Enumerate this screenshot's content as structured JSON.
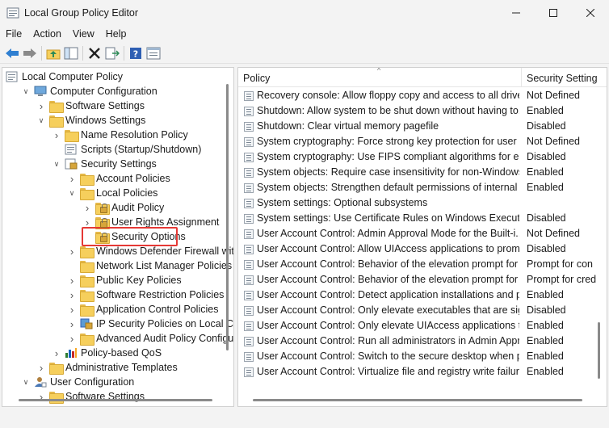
{
  "window": {
    "title": "Local Group Policy Editor"
  },
  "menu": [
    "File",
    "Action",
    "View",
    "Help"
  ],
  "toolbar": [
    "back-icon",
    "forward-icon",
    "up-folder-icon",
    "show-hide-tree-icon",
    "delete-icon",
    "export-list-icon",
    "help-icon",
    "properties-icon"
  ],
  "tree": [
    {
      "label": "Local Computer Policy",
      "icon": "computer-policy-icon",
      "depth": 0,
      "expander": ""
    },
    {
      "label": "Computer Configuration",
      "icon": "computer-icon",
      "depth": 1,
      "expander": "open"
    },
    {
      "label": "Software Settings",
      "icon": "folder-icon",
      "depth": 2,
      "expander": "closed"
    },
    {
      "label": "Windows Settings",
      "icon": "folder-icon",
      "depth": 2,
      "expander": "open"
    },
    {
      "label": "Name Resolution Policy",
      "icon": "folder-icon",
      "depth": 3,
      "expander": "closed"
    },
    {
      "label": "Scripts (Startup/Shutdown)",
      "icon": "script-icon",
      "depth": 3,
      "expander": ""
    },
    {
      "label": "Security Settings",
      "icon": "security-settings-icon",
      "depth": 3,
      "expander": "open"
    },
    {
      "label": "Account Policies",
      "icon": "folder-icon",
      "depth": 4,
      "expander": "closed"
    },
    {
      "label": "Local Policies",
      "icon": "folder-icon",
      "depth": 4,
      "expander": "open"
    },
    {
      "label": "Audit Policy",
      "icon": "locked-folder-icon",
      "depth": 5,
      "expander": "closed"
    },
    {
      "label": "User Rights Assignment",
      "icon": "locked-folder-icon",
      "depth": 5,
      "expander": "closed"
    },
    {
      "label": "Security Options",
      "icon": "locked-folder-icon",
      "depth": 5,
      "expander": "",
      "selected": true
    },
    {
      "label": "Windows Defender Firewall with",
      "icon": "folder-icon",
      "depth": 4,
      "expander": "closed"
    },
    {
      "label": "Network List Manager Policies",
      "icon": "folder-icon",
      "depth": 4,
      "expander": ""
    },
    {
      "label": "Public Key Policies",
      "icon": "folder-icon",
      "depth": 4,
      "expander": "closed"
    },
    {
      "label": "Software Restriction Policies",
      "icon": "folder-icon",
      "depth": 4,
      "expander": "closed"
    },
    {
      "label": "Application Control Policies",
      "icon": "folder-icon",
      "depth": 4,
      "expander": "closed"
    },
    {
      "label": "IP Security Policies on Local Cor",
      "icon": "ip-security-icon",
      "depth": 4,
      "expander": "closed"
    },
    {
      "label": "Advanced Audit Policy Configur",
      "icon": "folder-icon",
      "depth": 4,
      "expander": "closed"
    },
    {
      "label": "Policy-based QoS",
      "icon": "chart-icon",
      "depth": 3,
      "expander": "closed"
    },
    {
      "label": "Administrative Templates",
      "icon": "folder-icon",
      "depth": 2,
      "expander": "closed"
    },
    {
      "label": "User Configuration",
      "icon": "user-icon",
      "depth": 1,
      "expander": "open"
    },
    {
      "label": "Software Settings",
      "icon": "folder-icon",
      "depth": 2,
      "expander": "closed"
    }
  ],
  "columns": {
    "policy": "Policy",
    "setting": "Security Setting"
  },
  "policies": [
    {
      "name": "Recovery console: Allow floppy copy and access to all drives...",
      "setting": "Not Defined"
    },
    {
      "name": "Shutdown: Allow system to be shut down without having to...",
      "setting": "Enabled"
    },
    {
      "name": "Shutdown: Clear virtual memory pagefile",
      "setting": "Disabled"
    },
    {
      "name": "System cryptography: Force strong key protection for user k...",
      "setting": "Not Defined"
    },
    {
      "name": "System cryptography: Use FIPS compliant algorithms for en...",
      "setting": "Disabled"
    },
    {
      "name": "System objects: Require case insensitivity for non-Windows ...",
      "setting": "Enabled"
    },
    {
      "name": "System objects: Strengthen default permissions of internal s...",
      "setting": "Enabled"
    },
    {
      "name": "System settings: Optional subsystems",
      "setting": ""
    },
    {
      "name": "System settings: Use Certificate Rules on Windows Executab...",
      "setting": "Disabled"
    },
    {
      "name": "User Account Control: Admin Approval Mode for the Built-i...",
      "setting": "Not Defined"
    },
    {
      "name": "User Account Control: Allow UIAccess applications to prom...",
      "setting": "Disabled"
    },
    {
      "name": "User Account Control: Behavior of the elevation prompt for ...",
      "setting": "Prompt for con"
    },
    {
      "name": "User Account Control: Behavior of the elevation prompt for ...",
      "setting": "Prompt for cred"
    },
    {
      "name": "User Account Control: Detect application installations and p...",
      "setting": "Enabled"
    },
    {
      "name": "User Account Control: Only elevate executables that are sig...",
      "setting": "Disabled"
    },
    {
      "name": "User Account Control: Only elevate UIAccess applications th...",
      "setting": "Enabled"
    },
    {
      "name": "User Account Control: Run all administrators in Admin Appr...",
      "setting": "Enabled"
    },
    {
      "name": "User Account Control: Switch to the secure desktop when pr...",
      "setting": "Enabled"
    },
    {
      "name": "User Account Control: Virtualize file and registry write failure...",
      "setting": "Enabled"
    }
  ],
  "colors": {
    "selection_outline": "#e53935",
    "folder": "#f6cf5c"
  }
}
